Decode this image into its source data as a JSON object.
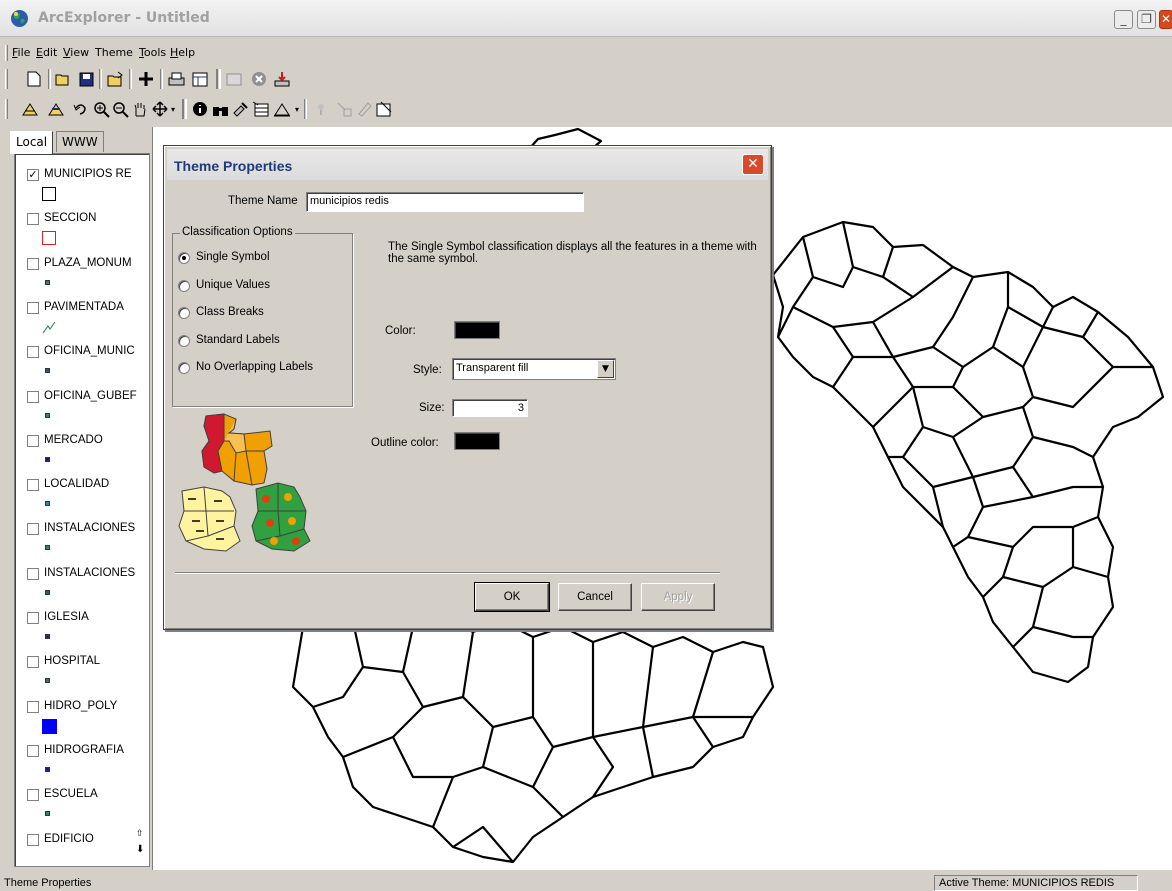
{
  "window": {
    "title": "ArcExplorer - Untitled"
  },
  "menu": [
    {
      "label": "File",
      "u": "F",
      "rest": "ile"
    },
    {
      "label": "Edit",
      "u": "E",
      "rest": "dit"
    },
    {
      "label": "View",
      "u": "V",
      "rest": "iew"
    },
    {
      "label": "Theme",
      "u": "",
      "rest": "Theme"
    },
    {
      "label": "Tools",
      "u": "T",
      "rest": "ools"
    },
    {
      "label": "Help",
      "u": "H",
      "rest": "elp"
    }
  ],
  "tabs": [
    "Local",
    "WWW"
  ],
  "layers": [
    {
      "name": "MUNICIPIOS RE",
      "checked": true,
      "symbol": "hollow-square",
      "color": "#000000"
    },
    {
      "name": "SECCION",
      "checked": false,
      "symbol": "hollow-square",
      "color": "#e02020"
    },
    {
      "name": "PLAZA_MONUM",
      "checked": false,
      "symbol": "small-square",
      "color": "#2e8b57"
    },
    {
      "name": "PAVIMENTADA",
      "checked": false,
      "symbol": "line",
      "color": "#1a7a4a"
    },
    {
      "name": "OFICINA_MUNIC",
      "checked": false,
      "symbol": "small-square",
      "color": "#1f5a8a"
    },
    {
      "name": "OFICINA_GUBEF",
      "checked": false,
      "symbol": "small-square",
      "color": "#2e8b57"
    },
    {
      "name": "MERCADO",
      "checked": false,
      "symbol": "small-square",
      "color": "#1a1a7a"
    },
    {
      "name": "LOCALIDAD",
      "checked": false,
      "symbol": "small-square",
      "color": "#2a8a9a"
    },
    {
      "name": "INSTALACIONES",
      "checked": false,
      "symbol": "small-square",
      "color": "#2e8b57"
    },
    {
      "name": "INSTALACIONES",
      "checked": false,
      "symbol": "small-square",
      "color": "#1f6a7a"
    },
    {
      "name": "IGLESIA",
      "checked": false,
      "symbol": "small-square",
      "color": "#2020a0"
    },
    {
      "name": "HOSPITAL",
      "checked": false,
      "symbol": "small-square",
      "color": "#3a7a3a"
    },
    {
      "name": "HIDRO_POLY",
      "checked": false,
      "symbol": "big-square",
      "color": "#0000ff"
    },
    {
      "name": "HIDROGRAFIA",
      "checked": false,
      "symbol": "small-square",
      "color": "#1a1aa0"
    },
    {
      "name": "ESCUELA",
      "checked": false,
      "symbol": "small-square",
      "color": "#2e8b57"
    },
    {
      "name": "EDIFICIO",
      "checked": false,
      "symbol": "none",
      "color": "#000000"
    }
  ],
  "dialog": {
    "title": "Theme Properties",
    "theme_name_label": "Theme Name",
    "theme_name_value": "municipios redis",
    "classification_group": "Classification Options",
    "options": [
      {
        "label": "Single Symbol",
        "selected": true
      },
      {
        "label": "Unique Values",
        "selected": false
      },
      {
        "label": "Class Breaks",
        "selected": false
      },
      {
        "label": "Standard Labels",
        "selected": false
      },
      {
        "label": "No Overlapping Labels",
        "selected": false
      }
    ],
    "description": "The Single Symbol classification displays all the features in a theme with the same symbol.",
    "color_label": "Color:",
    "color_value": "#000000",
    "style_label": "Style:",
    "style_value": "Transparent fill",
    "size_label": "Size:",
    "size_value": "3",
    "outline_label": "Outline color:",
    "outline_value": "#000000",
    "ok": "OK",
    "cancel": "Cancel",
    "apply": "Apply"
  },
  "status": {
    "left": "Theme Properties",
    "right": "Active Theme: MUNICIPIOS REDIS"
  }
}
